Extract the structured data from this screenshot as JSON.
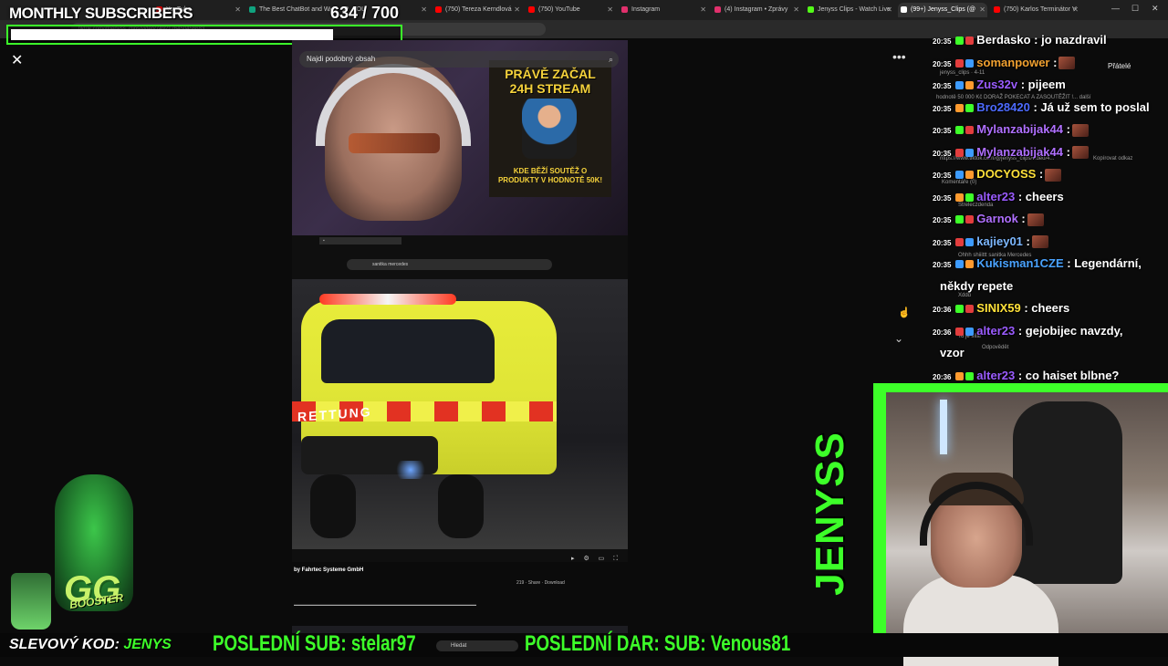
{
  "browser": {
    "tabs": [
      {
        "label": "YouTube",
        "color": "#ff0000"
      },
      {
        "label": "The Best ChatBot and W",
        "color": "#10a37f"
      },
      {
        "label": "SOL",
        "color": "#888888"
      },
      {
        "label": "(750) Tereza Kerndlová",
        "color": "#ff0000"
      },
      {
        "label": "(750) YouTube",
        "color": "#ff0000"
      },
      {
        "label": "Instagram",
        "color": "#e1306c"
      },
      {
        "label": "(4) Instagram • Zprávy",
        "color": "#e1306c"
      },
      {
        "label": "Jenyss Clips - Watch Live",
        "color": "#53fc18"
      },
      {
        "label": "(99+) Jenyss_Clips (@",
        "color": "#ffffff"
      },
      {
        "label": "(750) Karlos Terminátor V",
        "color": "#ff0000"
      }
    ],
    "url": "tiktok.com/@jenyss_clips/video/7492176450456683"
  },
  "overlay": {
    "monthly_label": "MONTHLY SUBSCRIBERS",
    "sub_count": "634 / 700",
    "progress_fraction": 0.906
  },
  "viewer": {
    "close_icon": "close-icon",
    "search_similar": "Najdi podobný obsah",
    "promo_title": "PRÁVĚ ZAČAL 24H STREAM",
    "promo_body": "KDE BĚŽÍ SOUTĚŽ O PRODUKTY V HODNOTĚ 50K!",
    "mini_search": "sanitka mercedes",
    "rettung": "RETTUNG",
    "author_caption": "by Fahrtec Systeme GmbH",
    "actions": "219  ·  Share  ·  Download"
  },
  "chat": {
    "messages": [
      {
        "time": "20:35",
        "user": "Berdasko",
        "color": "#ffffff",
        "text": ": jo nazdravil"
      },
      {
        "time": "20:35",
        "user": "somanpower",
        "color": "#f0a030",
        "text": ":"
      },
      {
        "time": "20:35",
        "user": "Zus32v",
        "color": "#9b5cff",
        "text": ": pijeem"
      },
      {
        "time": "20:35",
        "user": "Bro28420",
        "color": "#4d6bff",
        "text": ": Já už sem to poslal"
      },
      {
        "time": "20:35",
        "user": "Mylanzabijak44",
        "color": "#b070ff",
        "text": ":"
      },
      {
        "time": "20:35",
        "user": "Mylanzabijak44",
        "color": "#b070ff",
        "text": ":"
      },
      {
        "time": "20:35",
        "user": "DOCYOSS",
        "color": "#ffe13a",
        "text": ":"
      },
      {
        "time": "20:35",
        "user": "alter23",
        "color": "#9b5cff",
        "text": ": cheers"
      },
      {
        "time": "20:35",
        "user": "Garnok",
        "color": "#b070ff",
        "text": ":"
      },
      {
        "time": "20:35",
        "user": "kajiey01",
        "color": "#7db8ff",
        "text": ":"
      },
      {
        "time": "20:35",
        "user": "Kukisman1CZE",
        "color": "#4aa3ff",
        "text": ": Legendární,"
      },
      {
        "time": "",
        "user": "",
        "color": "#ffffff",
        "text": "někdy repete"
      },
      {
        "time": "20:36",
        "user": "SINIX59",
        "color": "#ffe13a",
        "text": ": cheers"
      },
      {
        "time": "20:36",
        "user": "alter23",
        "color": "#9b5cff",
        "text": ": gejobijec navzdy,"
      },
      {
        "time": "",
        "user": "",
        "color": "#ffffff",
        "text": "vzor"
      },
      {
        "time": "20:36",
        "user": "alter23",
        "color": "#9b5cff",
        "text": ": co haiset blbne?"
      }
    ],
    "ghost_friends": "Přátelé",
    "ghost_lines": [
      "jenyss_clips · 4-11",
      "hodnotě 50 000 Kč DORAŽ POKECAT A ZASOUTĚŽIT !... další",
      "https://www.tiktok.com/@jenyss_clips/video/4...",
      "Kopírovat odkaz",
      "Komentáře (0)",
      "Streleczdenda",
      "Ohhh shiiittt sanitka Mercedes",
      "Xddd",
      "To je síla!",
      "Odpovědět"
    ]
  },
  "webcam": {
    "brand_vertical": "JENYSS"
  },
  "mascot": {
    "logo": "GG",
    "booster": "BOOSTER"
  },
  "bottom": {
    "discount_label": "SLEVOVÝ KOD: ",
    "discount_code": "JENYS",
    "last_sub": "POSLEDNÍ SUB: stelar97",
    "last_donation": "POSLEDNÍ DAR: SUB: Venous81",
    "win_search": "Hledat"
  }
}
